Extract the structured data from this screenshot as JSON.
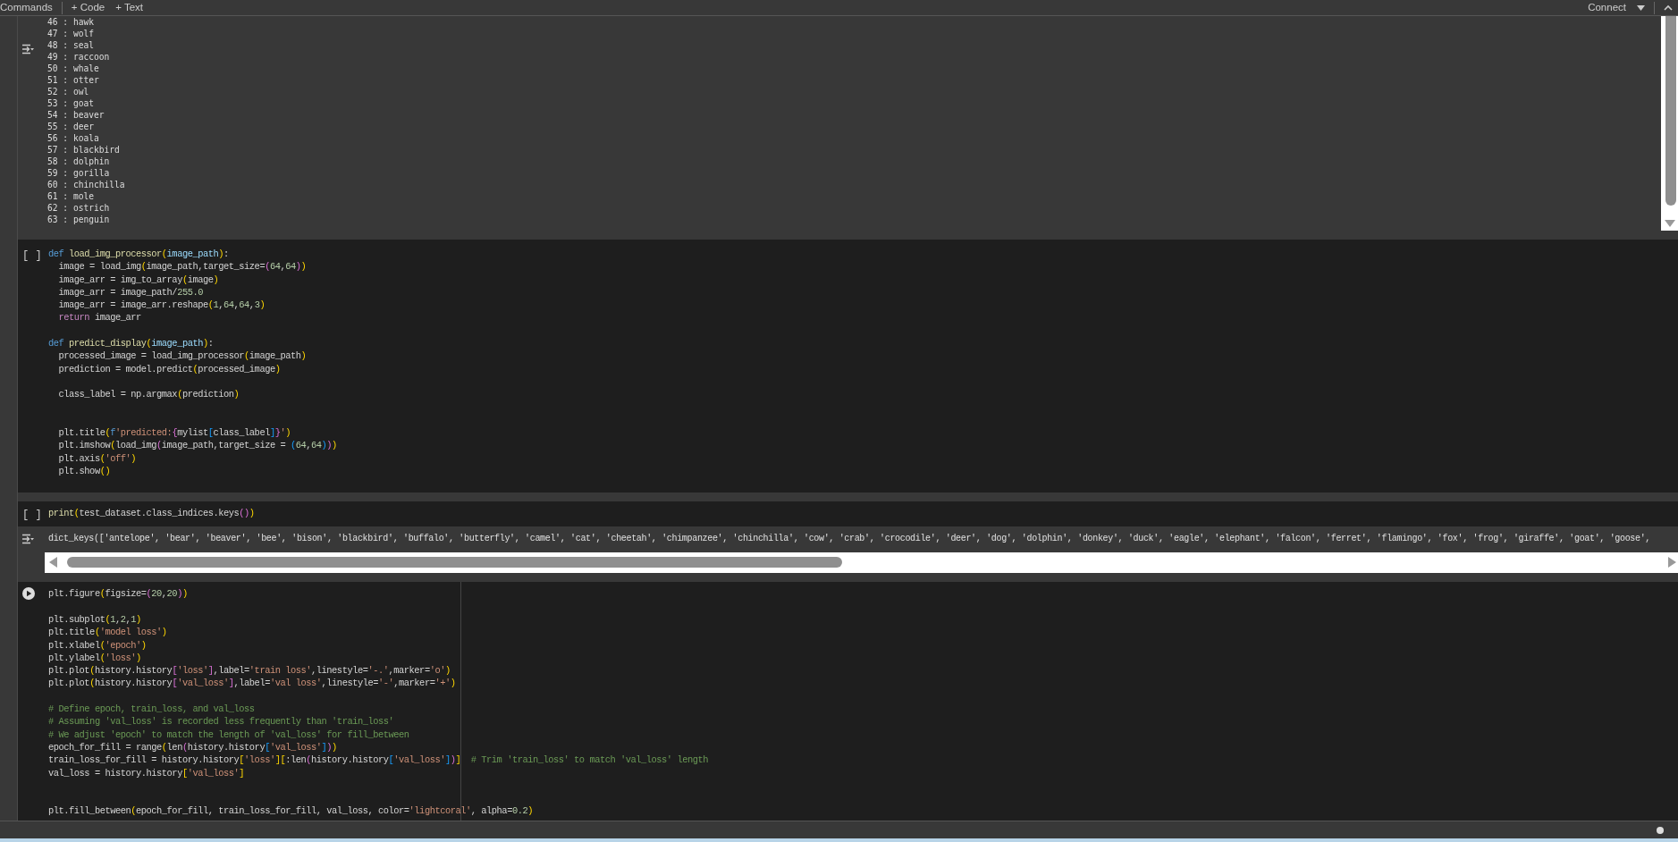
{
  "toolbar": {
    "commands": "Commands",
    "add_code": "+ Code",
    "add_text": "+ Text",
    "connect": "Connect"
  },
  "cells": [
    {
      "kind": "output",
      "output_lines": [
        "46 : hawk",
        "47 : wolf",
        "48 : seal",
        "49 : raccoon",
        "50 : whale",
        "51 : otter",
        "52 : owl",
        "53 : goat",
        "54 : beaver",
        "55 : deer",
        "56 : koala",
        "57 : blackbird",
        "58 : dolphin",
        "59 : gorilla",
        "60 : chinchilla",
        "61 : mole",
        "62 : ostrich",
        "63 : penguin"
      ]
    },
    {
      "kind": "code",
      "prompt": "[ ]",
      "lines": [
        {
          "kind": "code",
          "segs": [
            {
              "kind": "keyword",
              "text": "def "
            },
            {
              "kind": "function",
              "text": "load_img_processor"
            },
            {
              "kind": "bracket1",
              "text": "("
            },
            {
              "kind": "param",
              "text": "image_path"
            },
            {
              "kind": "bracket1",
              "text": ")"
            },
            {
              "kind": "plain",
              "text": ":"
            }
          ]
        },
        {
          "kind": "code",
          "segs": [
            {
              "kind": "plain",
              "text": "  image = load_img"
            },
            {
              "kind": "bracket1",
              "text": "("
            },
            {
              "kind": "plain",
              "text": "image_path,target_size="
            },
            {
              "kind": "bracket2",
              "text": "("
            },
            {
              "kind": "number",
              "text": "64"
            },
            {
              "kind": "plain",
              "text": ","
            },
            {
              "kind": "number",
              "text": "64"
            },
            {
              "kind": "bracket2",
              "text": ")"
            },
            {
              "kind": "bracket1",
              "text": ")"
            }
          ]
        },
        {
          "kind": "code",
          "segs": [
            {
              "kind": "plain",
              "text": "  image_arr = img_to_array"
            },
            {
              "kind": "bracket1",
              "text": "("
            },
            {
              "kind": "plain",
              "text": "image"
            },
            {
              "kind": "bracket1",
              "text": ")"
            }
          ]
        },
        {
          "kind": "code",
          "segs": [
            {
              "kind": "plain",
              "text": "  image_arr = image_path/"
            },
            {
              "kind": "number",
              "text": "255.0"
            }
          ]
        },
        {
          "kind": "code",
          "segs": [
            {
              "kind": "plain",
              "text": "  image_arr = image_arr.reshape"
            },
            {
              "kind": "bracket1",
              "text": "("
            },
            {
              "kind": "number",
              "text": "1"
            },
            {
              "kind": "plain",
              "text": ","
            },
            {
              "kind": "number",
              "text": "64"
            },
            {
              "kind": "plain",
              "text": ","
            },
            {
              "kind": "number",
              "text": "64"
            },
            {
              "kind": "plain",
              "text": ","
            },
            {
              "kind": "number",
              "text": "3"
            },
            {
              "kind": "bracket1",
              "text": ")"
            }
          ]
        },
        {
          "kind": "code",
          "segs": [
            {
              "kind": "control",
              "text": "  return"
            },
            {
              "kind": "plain",
              "text": " image_arr"
            }
          ]
        },
        {
          "kind": "blank"
        },
        {
          "kind": "code",
          "segs": [
            {
              "kind": "keyword",
              "text": "def "
            },
            {
              "kind": "function",
              "text": "predict_display"
            },
            {
              "kind": "bracket1",
              "text": "("
            },
            {
              "kind": "param",
              "text": "image_path"
            },
            {
              "kind": "bracket1",
              "text": ")"
            },
            {
              "kind": "plain",
              "text": ":"
            }
          ]
        },
        {
          "kind": "code",
          "segs": [
            {
              "kind": "plain",
              "text": "  processed_image = load_img_processor"
            },
            {
              "kind": "bracket1",
              "text": "("
            },
            {
              "kind": "plain",
              "text": "image_path"
            },
            {
              "kind": "bracket1",
              "text": ")"
            }
          ]
        },
        {
          "kind": "code",
          "segs": [
            {
              "kind": "plain",
              "text": "  prediction = model.predict"
            },
            {
              "kind": "bracket1",
              "text": "("
            },
            {
              "kind": "plain",
              "text": "processed_image"
            },
            {
              "kind": "bracket1",
              "text": ")"
            }
          ]
        },
        {
          "kind": "blank"
        },
        {
          "kind": "code",
          "segs": [
            {
              "kind": "plain",
              "text": "  class_label = np.argmax"
            },
            {
              "kind": "bracket1",
              "text": "("
            },
            {
              "kind": "plain",
              "text": "prediction"
            },
            {
              "kind": "bracket1",
              "text": ")"
            }
          ]
        },
        {
          "kind": "blank"
        },
        {
          "kind": "blank"
        },
        {
          "kind": "code",
          "segs": [
            {
              "kind": "plain",
              "text": "  plt.title"
            },
            {
              "kind": "bracket1",
              "text": "("
            },
            {
              "kind": "keyword",
              "text": "f"
            },
            {
              "kind": "string",
              "text": "'predicted:"
            },
            {
              "kind": "bracket2",
              "text": "{"
            },
            {
              "kind": "plain",
              "text": "mylist"
            },
            {
              "kind": "bracket3",
              "text": "["
            },
            {
              "kind": "plain",
              "text": "class_label"
            },
            {
              "kind": "bracket3",
              "text": "]"
            },
            {
              "kind": "bracket2",
              "text": "}"
            },
            {
              "kind": "string",
              "text": "'"
            },
            {
              "kind": "bracket1",
              "text": ")"
            }
          ]
        },
        {
          "kind": "code",
          "segs": [
            {
              "kind": "plain",
              "text": "  plt.imshow"
            },
            {
              "kind": "bracket1",
              "text": "("
            },
            {
              "kind": "plain",
              "text": "load_img"
            },
            {
              "kind": "bracket2",
              "text": "("
            },
            {
              "kind": "plain",
              "text": "image_path,target_size = "
            },
            {
              "kind": "bracket3",
              "text": "("
            },
            {
              "kind": "number",
              "text": "64"
            },
            {
              "kind": "plain",
              "text": ","
            },
            {
              "kind": "number",
              "text": "64"
            },
            {
              "kind": "bracket3",
              "text": ")"
            },
            {
              "kind": "bracket2",
              "text": ")"
            },
            {
              "kind": "bracket1",
              "text": ")"
            }
          ]
        },
        {
          "kind": "code",
          "segs": [
            {
              "kind": "plain",
              "text": "  plt.axis"
            },
            {
              "kind": "bracket1",
              "text": "("
            },
            {
              "kind": "string",
              "text": "'off'"
            },
            {
              "kind": "bracket1",
              "text": ")"
            }
          ]
        },
        {
          "kind": "code",
          "segs": [
            {
              "kind": "plain",
              "text": "  plt.show"
            },
            {
              "kind": "bracket1",
              "text": "()"
            }
          ]
        }
      ]
    },
    {
      "kind": "code",
      "prompt": "[ ]",
      "lines": [
        {
          "kind": "code",
          "segs": [
            {
              "kind": "function",
              "text": "print"
            },
            {
              "kind": "bracket1",
              "text": "("
            },
            {
              "kind": "plain",
              "text": "test_dataset.class_indices.keys"
            },
            {
              "kind": "bracket2",
              "text": "()"
            },
            {
              "kind": "bracket1",
              "text": ")"
            }
          ]
        }
      ],
      "output_text": "dict_keys(['antelope', 'bear', 'beaver', 'bee', 'bison', 'blackbird', 'buffalo', 'butterfly', 'camel', 'cat', 'cheetah', 'chimpanzee', 'chinchilla', 'cow', 'crab', 'crocodile', 'deer', 'dog', 'dolphin', 'donkey', 'duck', 'eagle', 'elephant', 'falcon', 'ferret', 'flamingo', 'fox', 'frog', 'giraffe', 'goat', 'goose',"
    },
    {
      "kind": "code",
      "run_button": true,
      "lines": [
        {
          "kind": "code",
          "segs": [
            {
              "kind": "plain",
              "text": "plt.figure"
            },
            {
              "kind": "bracket1",
              "text": "("
            },
            {
              "kind": "plain",
              "text": "figsize="
            },
            {
              "kind": "bracket2",
              "text": "("
            },
            {
              "kind": "number",
              "text": "20"
            },
            {
              "kind": "plain",
              "text": ","
            },
            {
              "kind": "number",
              "text": "20"
            },
            {
              "kind": "bracket2",
              "text": ")"
            },
            {
              "kind": "bracket1",
              "text": ")"
            }
          ]
        },
        {
          "kind": "blank"
        },
        {
          "kind": "code",
          "segs": [
            {
              "kind": "plain",
              "text": "plt.subplot"
            },
            {
              "kind": "bracket1",
              "text": "("
            },
            {
              "kind": "number",
              "text": "1"
            },
            {
              "kind": "plain",
              "text": ","
            },
            {
              "kind": "number",
              "text": "2"
            },
            {
              "kind": "plain",
              "text": ","
            },
            {
              "kind": "number",
              "text": "1"
            },
            {
              "kind": "bracket1",
              "text": ")"
            }
          ]
        },
        {
          "kind": "code",
          "segs": [
            {
              "kind": "plain",
              "text": "plt.title"
            },
            {
              "kind": "bracket1",
              "text": "("
            },
            {
              "kind": "string",
              "text": "'model loss'"
            },
            {
              "kind": "bracket1",
              "text": ")"
            }
          ]
        },
        {
          "kind": "code",
          "segs": [
            {
              "kind": "plain",
              "text": "plt.xlabel"
            },
            {
              "kind": "bracket1",
              "text": "("
            },
            {
              "kind": "string",
              "text": "'epoch'"
            },
            {
              "kind": "bracket1",
              "text": ")"
            }
          ]
        },
        {
          "kind": "code",
          "segs": [
            {
              "kind": "plain",
              "text": "plt.ylabel"
            },
            {
              "kind": "bracket1",
              "text": "("
            },
            {
              "kind": "string",
              "text": "'loss'"
            },
            {
              "kind": "bracket1",
              "text": ")"
            }
          ]
        },
        {
          "kind": "code",
          "segs": [
            {
              "kind": "plain",
              "text": "plt.plot"
            },
            {
              "kind": "bracket1",
              "text": "("
            },
            {
              "kind": "plain",
              "text": "history.history"
            },
            {
              "kind": "bracket2",
              "text": "["
            },
            {
              "kind": "string",
              "text": "'loss'"
            },
            {
              "kind": "bracket2",
              "text": "]"
            },
            {
              "kind": "plain",
              "text": ",label="
            },
            {
              "kind": "string",
              "text": "'train loss'"
            },
            {
              "kind": "plain",
              "text": ",linestyle="
            },
            {
              "kind": "string",
              "text": "'-.'"
            },
            {
              "kind": "plain",
              "text": ",marker="
            },
            {
              "kind": "string",
              "text": "'o'"
            },
            {
              "kind": "bracket1",
              "text": ")"
            }
          ]
        },
        {
          "kind": "code",
          "segs": [
            {
              "kind": "plain",
              "text": "plt.plot"
            },
            {
              "kind": "bracket1",
              "text": "("
            },
            {
              "kind": "plain",
              "text": "history.history"
            },
            {
              "kind": "bracket2",
              "text": "["
            },
            {
              "kind": "string",
              "text": "'val_loss'"
            },
            {
              "kind": "bracket2",
              "text": "]"
            },
            {
              "kind": "plain",
              "text": ",label="
            },
            {
              "kind": "string",
              "text": "'val loss'"
            },
            {
              "kind": "plain",
              "text": ",linestyle="
            },
            {
              "kind": "string",
              "text": "'-'"
            },
            {
              "kind": "plain",
              "text": ",marker="
            },
            {
              "kind": "string",
              "text": "'+'"
            },
            {
              "kind": "bracket1",
              "text": ")"
            }
          ]
        },
        {
          "kind": "blank"
        },
        {
          "kind": "code",
          "segs": [
            {
              "kind": "comment",
              "text": "# Define epoch, train_loss, and val_loss"
            }
          ]
        },
        {
          "kind": "code",
          "segs": [
            {
              "kind": "comment",
              "text": "# Assuming 'val_loss' is recorded less frequently than 'train_loss'"
            }
          ]
        },
        {
          "kind": "code",
          "segs": [
            {
              "kind": "comment",
              "text": "# We adjust 'epoch' to match the length of 'val_loss' for fill_between"
            }
          ]
        },
        {
          "kind": "code",
          "segs": [
            {
              "kind": "plain",
              "text": "epoch_for_fill = range"
            },
            {
              "kind": "bracket1",
              "text": "("
            },
            {
              "kind": "plain",
              "text": "len"
            },
            {
              "kind": "bracket2",
              "text": "("
            },
            {
              "kind": "plain",
              "text": "history.history"
            },
            {
              "kind": "bracket3",
              "text": "["
            },
            {
              "kind": "string",
              "text": "'val_loss'"
            },
            {
              "kind": "bracket3",
              "text": "]"
            },
            {
              "kind": "bracket2",
              "text": ")"
            },
            {
              "kind": "bracket1",
              "text": ")"
            }
          ]
        },
        {
          "kind": "code",
          "segs": [
            {
              "kind": "plain",
              "text": "train_loss_for_fill = history.history"
            },
            {
              "kind": "bracket1",
              "text": "["
            },
            {
              "kind": "string",
              "text": "'loss'"
            },
            {
              "kind": "bracket1",
              "text": "]["
            },
            {
              "kind": "plain",
              "text": ":len"
            },
            {
              "kind": "bracket2",
              "text": "("
            },
            {
              "kind": "plain",
              "text": "history.history"
            },
            {
              "kind": "bracket3",
              "text": "["
            },
            {
              "kind": "string",
              "text": "'val_loss'"
            },
            {
              "kind": "bracket3",
              "text": "]"
            },
            {
              "kind": "bracket2",
              "text": ")"
            },
            {
              "kind": "bracket1",
              "text": "]"
            },
            {
              "kind": "comment",
              "text": "  # Trim 'train_loss' to match 'val_loss' length"
            }
          ]
        },
        {
          "kind": "code",
          "segs": [
            {
              "kind": "plain",
              "text": "val_loss = history.history"
            },
            {
              "kind": "bracket1",
              "text": "["
            },
            {
              "kind": "string",
              "text": "'val_loss'"
            },
            {
              "kind": "bracket1",
              "text": "]"
            }
          ]
        },
        {
          "kind": "blank"
        },
        {
          "kind": "blank"
        },
        {
          "kind": "code",
          "segs": [
            {
              "kind": "plain",
              "text": "plt.fill_between"
            },
            {
              "kind": "bracket1",
              "text": "("
            },
            {
              "kind": "plain",
              "text": "epoch_for_fill, train_loss_for_fill, val_loss, color="
            },
            {
              "kind": "string",
              "text": "'lightcoral'"
            },
            {
              "kind": "plain",
              "text": ", alpha="
            },
            {
              "kind": "number",
              "text": "0.2"
            },
            {
              "kind": "bracket1",
              "text": ")"
            }
          ]
        }
      ]
    }
  ]
}
